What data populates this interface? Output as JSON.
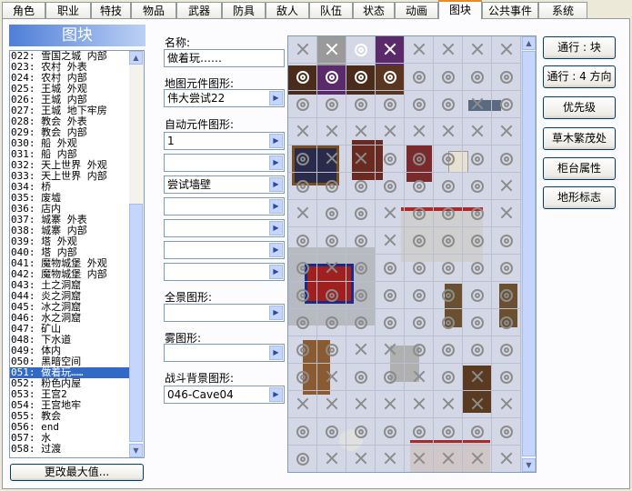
{
  "tabs": [
    "角色",
    "职业",
    "特技",
    "物品",
    "武器",
    "防具",
    "敌人",
    "队伍",
    "状态",
    "动画",
    "图块",
    "公共事件",
    "系统"
  ],
  "active_tab": "图块",
  "list_header": "图块",
  "tileset_list": [
    "022: 雪国之城 内部",
    "023: 农村 外表",
    "024: 农村 内部",
    "025: 王城 外观",
    "026: 王城 内部",
    "027: 王城 地下牢房",
    "028: 教会 外表",
    "029: 教会 内部",
    "030: 船 外观",
    "031: 船 内部",
    "032: 天上世界 外观",
    "033: 天上世界 内部",
    "034: 桥",
    "035: 废墟",
    "036: 店内",
    "037: 城寨 外表",
    "038: 城寨 内部",
    "039: 塔 外观",
    "040: 塔 内部",
    "041: 魔物城堡 外观",
    "042: 魔物城堡 内部",
    "043: 土之洞窟",
    "044: 炎之洞窟",
    "045: 冰之洞窟",
    "046: 水之洞窟",
    "047: 矿山",
    "048: 下水道",
    "049: 体内",
    "050: 黑暗空间",
    "051: 做着玩……",
    "052: 粉色内屋",
    "053: 王宫2",
    "054: 王宫地牢",
    "055: 教会",
    "056: end",
    "057: 水",
    "058: 过渡"
  ],
  "selected_index": 29,
  "change_max_button": "更改最大值...",
  "form": {
    "name_label": "名称:",
    "name_value": "做着玩……",
    "tileset_graphic_label": "地图元件图形:",
    "tileset_graphic_value": "伟大尝试22",
    "autotile_label": "自动元件图形:",
    "autotiles": [
      "1",
      "",
      "尝试墙壁",
      "",
      "",
      "",
      ""
    ],
    "panorama_label": "全景图形:",
    "panorama_value": "",
    "fog_label": "雾图形:",
    "fog_value": "",
    "battleback_label": "战斗背景图形:",
    "battleback_value": "046-Cave04"
  },
  "right_buttons": [
    "通行 : 块",
    "通行 : 4 方向",
    "优先级",
    "草木繁茂处",
    "柜台属性",
    "地形标志"
  ],
  "passage_grid": [
    "XXOXXXXX",
    "OOOOOOOO",
    "OOOOOOXO",
    "XXXXXXXX",
    "OXXOOOOO",
    "OOOOOOOX",
    "XOOXOOOX",
    "OOOXOOOO",
    "OXOOOOOO",
    "OOOOOOOO",
    "OOOOOOOO",
    "OOXXOOOO",
    "OXOOXOXO",
    "XXXXXXXX",
    "OOOOOOOO",
    "OXXXXXXX"
  ],
  "colors": {
    "accent_tab": "#e68b2c",
    "selection": "#316ac5",
    "header": "#4f7fd8",
    "grid_bg": "#d4d8e6"
  }
}
